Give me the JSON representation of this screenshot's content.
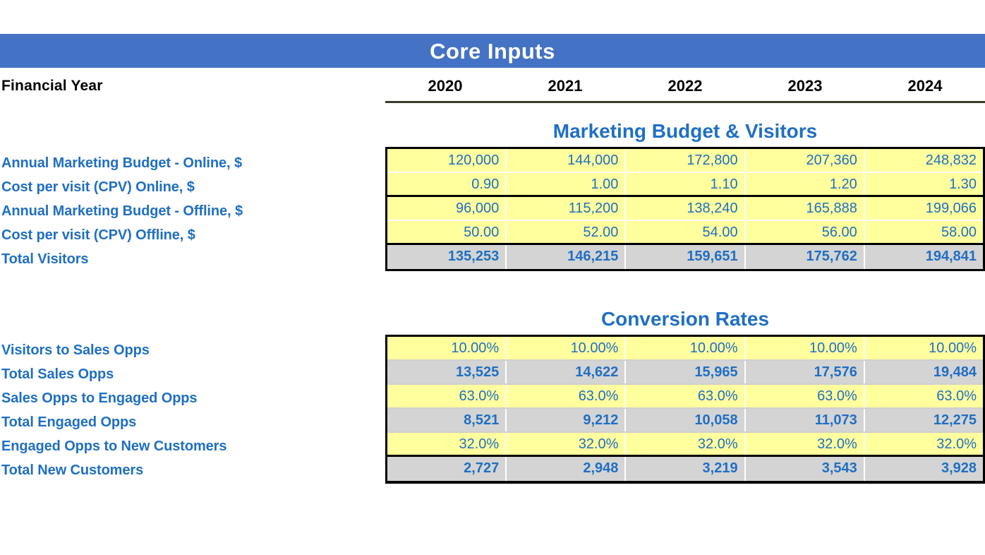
{
  "banner": {
    "title": "Core Inputs",
    "background_color": "#4472C4",
    "text_color": "#FFFFFF"
  },
  "header": {
    "row_label": "Financial Year",
    "years": [
      "2020",
      "2021",
      "2022",
      "2023",
      "2024"
    ]
  },
  "colors": {
    "accent_blue": "#1F6FC4",
    "input_yellow": "#FFFF9E",
    "calc_gray": "#D4D4D4",
    "border_black": "#000000"
  },
  "sections": [
    {
      "id": "marketing",
      "title": "Marketing Budget & Visitors",
      "rows": [
        {
          "label": "Annual Marketing Budget - Online, $",
          "type": "input",
          "values": [
            "120,000",
            "144,000",
            "172,800",
            "207,360",
            "248,832"
          ]
        },
        {
          "label": "Cost per visit (CPV) Online, $",
          "type": "input",
          "values": [
            "0.90",
            "1.00",
            "1.10",
            "1.20",
            "1.30"
          ]
        },
        {
          "label": "Annual Marketing Budget - Offline, $",
          "type": "input",
          "values": [
            "96,000",
            "115,200",
            "138,240",
            "165,888",
            "199,066"
          ]
        },
        {
          "label": "Cost per visit (CPV) Offline, $",
          "type": "input",
          "values": [
            "50.00",
            "52.00",
            "54.00",
            "56.00",
            "58.00"
          ]
        },
        {
          "label": "Total Visitors",
          "type": "calc",
          "values": [
            "135,253",
            "146,215",
            "159,651",
            "175,762",
            "194,841"
          ]
        }
      ]
    },
    {
      "id": "conversion",
      "title": "Conversion Rates",
      "rows": [
        {
          "label": "Visitors to Sales Opps",
          "type": "input",
          "values": [
            "10.00%",
            "10.00%",
            "10.00%",
            "10.00%",
            "10.00%"
          ]
        },
        {
          "label": "Total Sales Opps",
          "type": "calc",
          "values": [
            "13,525",
            "14,622",
            "15,965",
            "17,576",
            "19,484"
          ]
        },
        {
          "label": "Sales Opps to Engaged Opps",
          "type": "input",
          "values": [
            "63.0%",
            "63.0%",
            "63.0%",
            "63.0%",
            "63.0%"
          ]
        },
        {
          "label": "Total Engaged Opps",
          "type": "calc",
          "values": [
            "8,521",
            "9,212",
            "10,058",
            "11,073",
            "12,275"
          ]
        },
        {
          "label": "Engaged Opps to New Customers",
          "type": "input",
          "values": [
            "32.0%",
            "32.0%",
            "32.0%",
            "32.0%",
            "32.0%"
          ]
        },
        {
          "label": "Total New Customers",
          "type": "calc",
          "values": [
            "2,727",
            "2,948",
            "3,219",
            "3,543",
            "3,928"
          ]
        }
      ]
    }
  ],
  "chart_data": {
    "type": "table",
    "title": "Core Inputs",
    "categories": [
      "2020",
      "2021",
      "2022",
      "2023",
      "2024"
    ],
    "xlabel": "Financial Year",
    "ylabel": "",
    "series": [
      {
        "name": "Annual Marketing Budget - Online, $",
        "values": [
          120000,
          144000,
          172800,
          207360,
          248832
        ]
      },
      {
        "name": "Cost per visit (CPV) Online, $",
        "values": [
          0.9,
          1.0,
          1.1,
          1.2,
          1.3
        ]
      },
      {
        "name": "Annual Marketing Budget - Offline, $",
        "values": [
          96000,
          115200,
          138240,
          165888,
          199066
        ]
      },
      {
        "name": "Cost per visit (CPV) Offline, $",
        "values": [
          50.0,
          52.0,
          54.0,
          56.0,
          58.0
        ]
      },
      {
        "name": "Total Visitors",
        "values": [
          135253,
          146215,
          159651,
          175762,
          194841
        ]
      },
      {
        "name": "Visitors to Sales Opps",
        "values": [
          0.1,
          0.1,
          0.1,
          0.1,
          0.1
        ]
      },
      {
        "name": "Total Sales Opps",
        "values": [
          13525,
          14622,
          15965,
          17576,
          19484
        ]
      },
      {
        "name": "Sales Opps to Engaged Opps",
        "values": [
          0.63,
          0.63,
          0.63,
          0.63,
          0.63
        ]
      },
      {
        "name": "Total Engaged Opps",
        "values": [
          8521,
          9212,
          10058,
          11073,
          12275
        ]
      },
      {
        "name": "Engaged Opps to New Customers",
        "values": [
          0.32,
          0.32,
          0.32,
          0.32,
          0.32
        ]
      },
      {
        "name": "Total New Customers",
        "values": [
          2727,
          2948,
          3219,
          3543,
          3928
        ]
      }
    ]
  }
}
